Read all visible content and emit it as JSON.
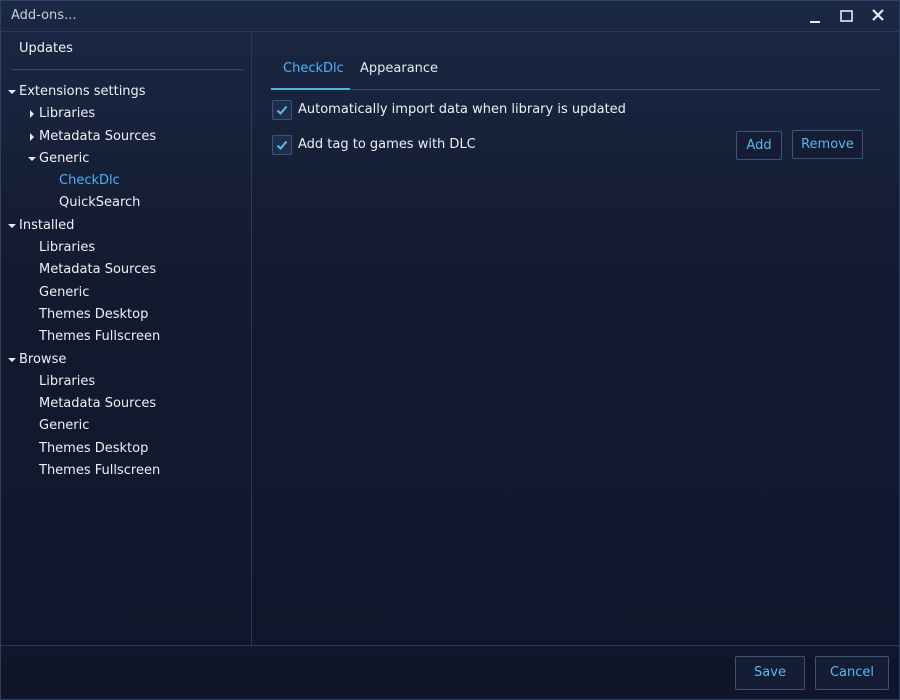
{
  "window": {
    "title": "Add-ons...",
    "controls": {
      "minimize": "minimize-icon",
      "maximize": "maximize-icon",
      "close": "close-icon"
    }
  },
  "sidebar": {
    "updates_label": "Updates",
    "tree": [
      {
        "label": "Extensions settings",
        "expanded": true,
        "level": 0
      },
      {
        "label": "Libraries",
        "expanded": false,
        "level": 1
      },
      {
        "label": "Metadata Sources",
        "expanded": false,
        "level": 1
      },
      {
        "label": "Generic",
        "expanded": true,
        "level": 1
      },
      {
        "label": "CheckDlc",
        "level": 2,
        "selected": true
      },
      {
        "label": "QuickSearch",
        "level": 2
      },
      {
        "label": "Installed",
        "expanded": true,
        "level": 0
      },
      {
        "label": "Libraries",
        "level": 1
      },
      {
        "label": "Metadata Sources",
        "level": 1
      },
      {
        "label": "Generic",
        "level": 1
      },
      {
        "label": "Themes Desktop",
        "level": 1
      },
      {
        "label": "Themes Fullscreen",
        "level": 1
      },
      {
        "label": "Browse",
        "expanded": true,
        "level": 0
      },
      {
        "label": "Libraries",
        "level": 1
      },
      {
        "label": "Metadata Sources",
        "level": 1
      },
      {
        "label": "Generic",
        "level": 1
      },
      {
        "label": "Themes Desktop",
        "level": 1
      },
      {
        "label": "Themes Fullscreen",
        "level": 1
      }
    ]
  },
  "content": {
    "tabs": [
      {
        "label": "CheckDlc",
        "active": true
      },
      {
        "label": "Appearance",
        "active": false
      }
    ],
    "options": [
      {
        "label": "Automatically import data when library is updated",
        "checked": true
      },
      {
        "label": "Add tag to games with DLC",
        "checked": true
      }
    ],
    "add_label": "Add",
    "remove_label": "Remove"
  },
  "footer": {
    "save_label": "Save",
    "cancel_label": "Cancel"
  },
  "colors": {
    "accent": "#4ab4f0",
    "background": "#111629",
    "border": "#2a3b57"
  }
}
